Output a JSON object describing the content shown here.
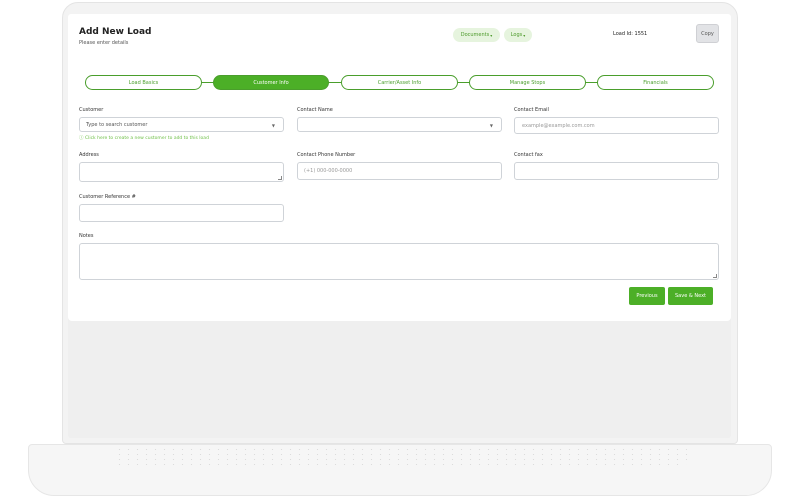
{
  "header": {
    "title": "Add New Load",
    "subtitle": "Please enter details",
    "documents_label": "Documents",
    "logs_label": "Logs",
    "load_id": "Load Id: 1551",
    "copy_label": "Copy"
  },
  "steps": [
    {
      "label": "Load Basics"
    },
    {
      "label": "Customer Info"
    },
    {
      "label": "Carrier/Asset Info"
    },
    {
      "label": "Manage Stops"
    },
    {
      "label": "Financials"
    }
  ],
  "form": {
    "customer": {
      "label": "Customer",
      "placeholder": "Type to search customer",
      "hint": "Click here to create a new customer to add to this load"
    },
    "contact_name": {
      "label": "Contact Name",
      "value": ""
    },
    "contact_email": {
      "label": "Contact Email",
      "placeholder": "example@example.com.com"
    },
    "address": {
      "label": "Address",
      "value": ""
    },
    "contact_phone": {
      "label": "Contact Phone Number",
      "placeholder": "(+1) 000-000-0000"
    },
    "contact_fax": {
      "label": "Contact fax",
      "value": ""
    },
    "customer_ref": {
      "label": "Customer Reference #",
      "value": ""
    },
    "notes": {
      "label": "Notes",
      "value": ""
    }
  },
  "buttons": {
    "previous": "Previous",
    "save_next": "Save & Next"
  },
  "colors": {
    "accent": "#4caf27",
    "accent_light": "#e6f4de",
    "hint": "#6cbf45"
  }
}
